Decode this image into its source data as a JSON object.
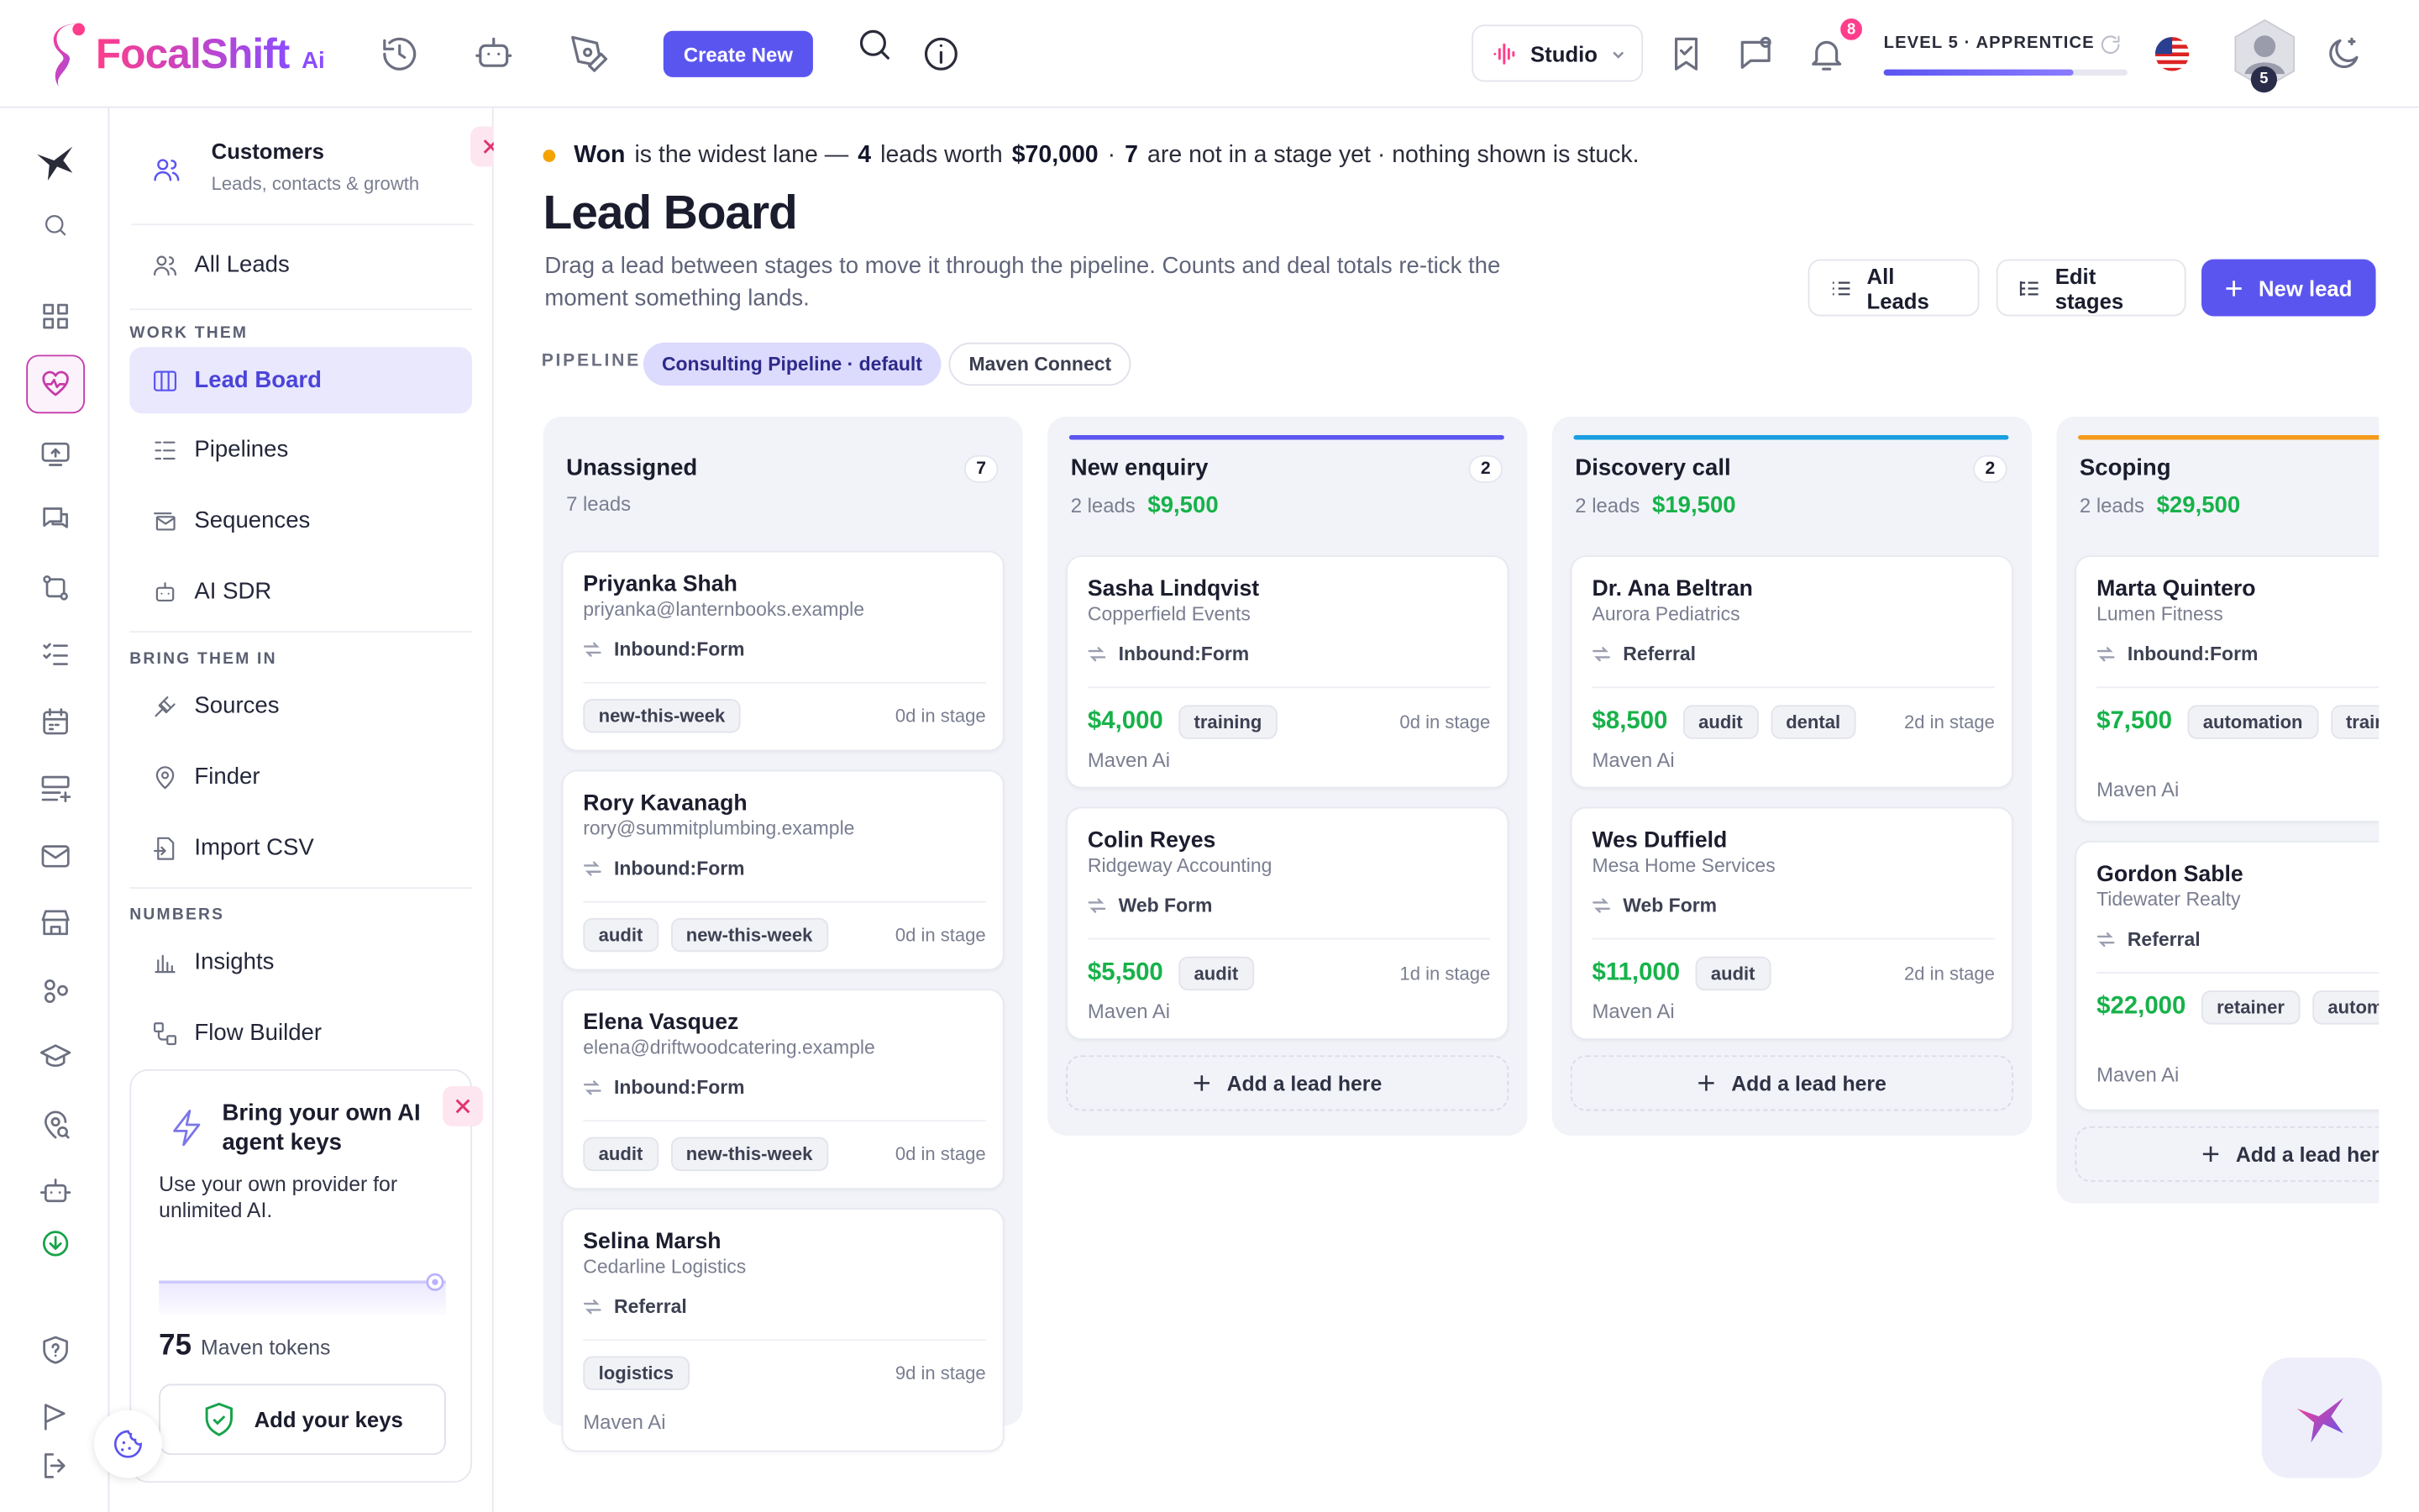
{
  "brand": {
    "name": "FocalShift",
    "suffix": "Ai"
  },
  "topbar": {
    "create_label": "Create New",
    "studio_label": "Studio",
    "notifications_count": "8",
    "level_label": "LEVEL 5 · APPRENTICE",
    "level_progress": 0.78,
    "avatar_level": "5"
  },
  "sidebar": {
    "header_title": "Customers",
    "header_subtitle": "Leads, contacts & growth",
    "all_leads": "All Leads",
    "section_work": "WORK THEM",
    "lead_board": "Lead Board",
    "pipelines": "Pipelines",
    "sequences": "Sequences",
    "ai_sdr": "AI SDR",
    "section_bring": "BRING THEM IN",
    "sources": "Sources",
    "finder": "Finder",
    "import_csv": "Import CSV",
    "section_numbers": "NUMBERS",
    "insights": "Insights",
    "flow_builder": "Flow Builder",
    "promo": {
      "title": "Bring your own AI agent keys",
      "desc": "Use your own provider for unlimited AI.",
      "tokens_value": "75",
      "tokens_label": "Maven tokens",
      "button": "Add your keys"
    }
  },
  "main": {
    "note": {
      "lane": "Won",
      "t1": "is the widest lane —",
      "count": "4",
      "t2": "leads worth",
      "worth": "$70,000",
      "t3": "·",
      "unstaged": "7",
      "t4": "are not in a stage yet · nothing shown is stuck."
    },
    "title": "Lead Board",
    "description": "Drag a lead between stages to move it through the pipeline. Counts and deal totals re-tick the moment something lands.",
    "btn_all_leads": "All Leads",
    "btn_edit_stages": "Edit stages",
    "btn_new_lead": "New lead",
    "pipeline_label": "PIPELINE",
    "pipelines": [
      "Consulting Pipeline · default",
      "Maven Connect"
    ],
    "add_label": "Add a lead here"
  },
  "lanes": [
    {
      "title": "Unassigned",
      "count": "7",
      "sub": "7 leads",
      "total": "",
      "color": "",
      "cards": [
        {
          "name": "Priyanka Shah",
          "sub": "priyanka@lanternbooks.example",
          "source": "Inbound:Form",
          "value": "",
          "tags": [
            "new-this-week"
          ],
          "age": "0d in stage",
          "owner": ""
        },
        {
          "name": "Rory Kavanagh",
          "sub": "rory@summitplumbing.example",
          "source": "Inbound:Form",
          "value": "",
          "tags": [
            "audit",
            "new-this-week"
          ],
          "age": "0d in stage",
          "owner": ""
        },
        {
          "name": "Elena Vasquez",
          "sub": "elena@driftwoodcatering.example",
          "source": "Inbound:Form",
          "value": "",
          "tags": [
            "audit",
            "new-this-week"
          ],
          "age": "0d in stage",
          "owner": ""
        },
        {
          "name": "Selina Marsh",
          "sub": "Cedarline Logistics",
          "source": "Referral",
          "value": "",
          "tags": [
            "logistics"
          ],
          "age": "9d in stage",
          "owner": "Maven Ai"
        }
      ]
    },
    {
      "title": "New enquiry",
      "count": "2",
      "sub": "2 leads",
      "total": "$9,500",
      "color": "#5b55f0",
      "cards": [
        {
          "name": "Sasha Lindqvist",
          "sub": "Copperfield Events",
          "source": "Inbound:Form",
          "value": "$4,000",
          "tags": [
            "training"
          ],
          "age": "0d in stage",
          "owner": "Maven Ai"
        },
        {
          "name": "Colin Reyes",
          "sub": "Ridgeway Accounting",
          "source": "Web Form",
          "value": "$5,500",
          "tags": [
            "audit"
          ],
          "age": "1d in stage",
          "owner": "Maven Ai"
        }
      ]
    },
    {
      "title": "Discovery call",
      "count": "2",
      "sub": "2 leads",
      "total": "$19,500",
      "color": "#1a9fe0",
      "cards": [
        {
          "name": "Dr. Ana Beltran",
          "sub": "Aurora Pediatrics",
          "source": "Referral",
          "value": "$8,500",
          "tags": [
            "audit",
            "dental"
          ],
          "age": "2d in stage",
          "owner": "Maven Ai"
        },
        {
          "name": "Wes Duffield",
          "sub": "Mesa Home Services",
          "source": "Web Form",
          "value": "$11,000",
          "tags": [
            "audit"
          ],
          "age": "2d in stage",
          "owner": "Maven Ai"
        }
      ]
    },
    {
      "title": "Scoping",
      "count": "",
      "sub": "2 leads",
      "total": "$29,500",
      "color": "#f59a1b",
      "cards": [
        {
          "name": "Marta Quintero",
          "sub": "Lumen Fitness",
          "source": "Inbound:Form",
          "value": "$7,500",
          "tags": [
            "automation",
            "training"
          ],
          "age": "",
          "owner": "Maven Ai"
        },
        {
          "name": "Gordon Sable",
          "sub": "Tidewater Realty",
          "source": "Referral",
          "value": "$22,000",
          "tags": [
            "retainer",
            "automation"
          ],
          "age": "",
          "owner": "Maven Ai"
        }
      ]
    }
  ]
}
